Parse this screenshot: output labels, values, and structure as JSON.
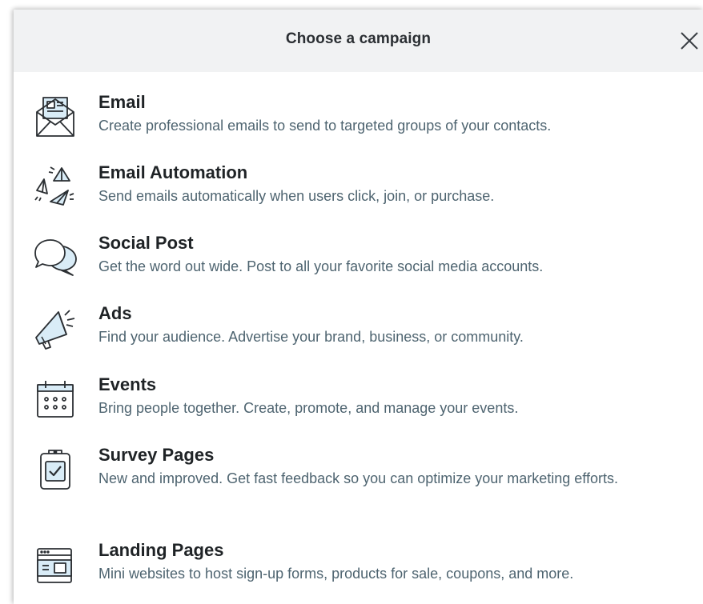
{
  "modal": {
    "title": "Choose a campaign",
    "close_icon": "close-x-icon"
  },
  "items": [
    {
      "title": "Email",
      "description": "Create professional emails to send to targeted groups of your contacts.",
      "icon": "envelope-newsletter-icon"
    },
    {
      "title": "Email Automation",
      "description": "Send emails automatically when users click, join, or purchase.",
      "icon": "paper-planes-icon"
    },
    {
      "title": "Social Post",
      "description": "Get the word out wide. Post to all your favorite social media accounts.",
      "icon": "speech-bubbles-icon"
    },
    {
      "title": "Ads",
      "description": "Find your audience. Advertise your brand, business, or community.",
      "icon": "megaphone-icon"
    },
    {
      "title": "Events",
      "description": "Bring people together. Create, promote, and manage your events.",
      "icon": "calendar-icon"
    },
    {
      "title": "Survey Pages",
      "description": "New and improved. Get fast feedback so you can optimize your marketing efforts.",
      "icon": "clipboard-check-icon"
    },
    {
      "title": "Landing Pages",
      "description": "Mini websites to host sign-up forms, products for sale, coupons, and more.",
      "icon": "browser-window-icon"
    }
  ],
  "colors": {
    "header_bg": "#f1f2f3",
    "title_text": "#1f2326",
    "desc_text": "#4e6470",
    "icon_stroke": "#2b2f33",
    "icon_fill": "#d9ecf7"
  }
}
